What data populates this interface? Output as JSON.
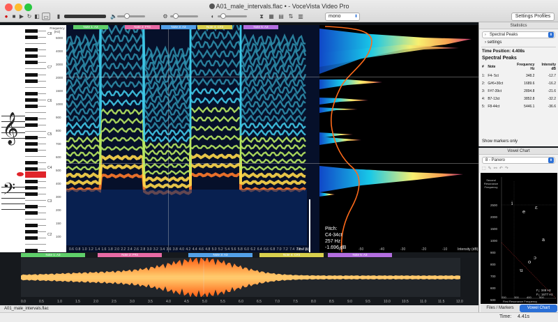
{
  "window": {
    "title": "A01_male_intervals.flac",
    "edited_marker": "•",
    "app_name": "- VoceVista Video Pro"
  },
  "toolbar": {
    "mode_select": "mono",
    "settings_profiles": "Settings Profiles"
  },
  "markers": [
    "Note 1: A3",
    "Note 2: F#3",
    "Note 3: A3",
    "Note 4: C#3",
    "Note 5: A3"
  ],
  "wave_markers": [
    "Note 1: A3",
    "Note 2: F#3",
    "Note 3: A3",
    "Note 4: C#3",
    "Note 5: A3"
  ],
  "freq_axis_title": "Frequency (Hz)",
  "freq_labels": [
    "5000",
    "4000",
    "3000",
    "2000",
    "1500",
    "1000",
    "900",
    "800",
    "700",
    "600",
    "500",
    "400",
    "300",
    "200",
    "150",
    "100"
  ],
  "note_labels": [
    "C8",
    "C7",
    "C6",
    "C5",
    "C4",
    "C3",
    "C2"
  ],
  "time_labels": [
    "0.6",
    "0.8",
    "1.0",
    "1.2",
    "1.4",
    "1.6",
    "1.8",
    "2.0",
    "2.2",
    "2.4",
    "2.6",
    "2.8",
    "3.0",
    "3.2",
    "3.4",
    "3.6",
    "3.8",
    "4.0",
    "4.2",
    "4.4",
    "4.6",
    "4.8",
    "5.0",
    "5.2",
    "5.4",
    "5.6",
    "5.8",
    "6.0",
    "6.2",
    "6.4",
    "6.6",
    "6.8",
    "7.0",
    "7.2",
    "7.4",
    "7.6",
    "7.8"
  ],
  "time_axis_title": "Time (s)",
  "spectrum_axis": [
    "-60",
    "-50",
    "-40",
    "-30",
    "-20",
    "-10"
  ],
  "spectrum_axis_title": "Intensity (dB)",
  "pitch_readout": {
    "label": "Pitch:",
    "note": "C4-34ct",
    "hz": "257 Hz",
    "db": "-1.696 dB"
  },
  "statistics": {
    "panel_title": "Statistics",
    "selector": "Spectral Peaks",
    "settings": "settings",
    "time_position": "Time Position: 4.408s",
    "peaks_title": "Spectral Peaks",
    "headers": [
      "#",
      "Note",
      "Frequency\nHz",
      "Intensity\ndB"
    ],
    "rows": [
      {
        "n": "1:",
        "note": "F4- 5ct",
        "freq": "348.2",
        "db": "-12.7"
      },
      {
        "n": "2:",
        "note": "G#6+30ct",
        "freq": "1689.6",
        "db": "-16.2"
      },
      {
        "n": "3:",
        "note": "F#7-39ct",
        "freq": "2894.8",
        "db": "-21.6"
      },
      {
        "n": "4:",
        "note": "B7-13ct",
        "freq": "3852.8",
        "db": "-32.2"
      },
      {
        "n": "5:",
        "note": "F8-44ct",
        "freq": "5446.1",
        "db": "-36.6"
      }
    ],
    "show_markers_only": "Show markers only"
  },
  "vowel_chart": {
    "panel_title": "Vowel Chart",
    "selector": "8 - Panero",
    "y_axis_title": "Second Resonance Frequency",
    "x_axis_title": "First Resonance Frequency",
    "y_labels": [
      "2500",
      "2000",
      "1500",
      "1000",
      "900",
      "800",
      "700",
      "600",
      "500"
    ],
    "x_labels": [
      "200",
      "300",
      "400",
      "500"
    ],
    "vowels": [
      "i",
      "e",
      "ɛ",
      "a",
      "ɔ",
      "o",
      "u"
    ],
    "f1_readout": "F₁: 348 Hz",
    "f2_readout": "F₂: 1677 Hz",
    "tab_files": "Files / Markers",
    "tab_vowel": "Vowel Chart"
  },
  "wave_time_labels": [
    "0.0",
    "0.5",
    "1.0",
    "1.5",
    "2.0",
    "2.5",
    "3.0",
    "3.5",
    "4.0",
    "4.5",
    "5.0",
    "5.5",
    "6.0",
    "6.5",
    "7.0",
    "7.5",
    "8.0",
    "8.5",
    "9.0",
    "9.5",
    "10.0",
    "10.5",
    "11.0",
    "11.5",
    "12.0"
  ],
  "file_tab": "A01_male_intervals.flac",
  "status": {
    "time_label": "Time:",
    "time_value": "4.41s"
  },
  "colors": {
    "marker_1": "#5fcf6a",
    "marker_2": "#e86aa5",
    "marker_3": "#53a0e8",
    "marker_4": "#d8d04e",
    "marker_5": "#b36ee0",
    "accent_orange": "#ff6a1a",
    "tab_selected": "#2a6fd6"
  }
}
